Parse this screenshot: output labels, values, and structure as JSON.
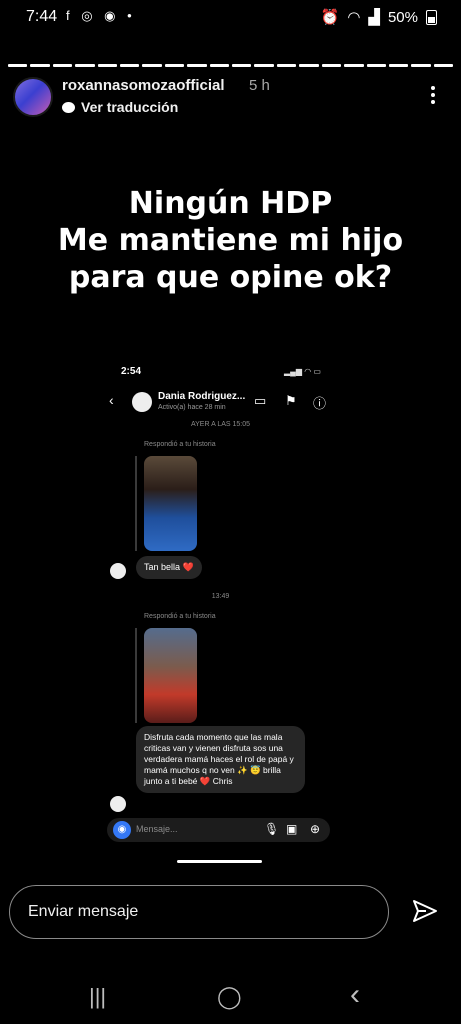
{
  "status_bar": {
    "time": "7:44",
    "app_icons": "f ◎ ◉ •",
    "battery": "50%"
  },
  "story": {
    "username": "roxannasomozaofficial",
    "age": "5 h",
    "translate": "Ver traducción",
    "text_lines": [
      "Ningún HDP",
      "Me mantiene mi hijo",
      "para que opine ok?"
    ]
  },
  "embedded": {
    "time": "2:54",
    "contact_name": "Dania Rodriguez...",
    "contact_status": "Activo(a) hace 28 min",
    "date_divider": "AYER A LAS 15:05",
    "replied_1": "Respondió a tu historia",
    "message_1": "Tan bella ❤️",
    "time_divider": "13:49",
    "replied_2": "Respondió a tu historia",
    "message_2": "Disfruta cada momento que las mala criticas van y vienen disfruta sos una verdadera mamá haces el rol de papá y mamá muchos q no ven ✨ 😇 brilla junto a ti bebé ❤️ Chris",
    "input_placeholder": "Mensaje..."
  },
  "reply": {
    "placeholder": "Enviar mensaje"
  },
  "nav": {
    "recents": "|||",
    "home": "◯",
    "back": "‹"
  },
  "icons": [
    "facebook-icon",
    "instagram-icon",
    "messenger-icon",
    "alarm-icon",
    "wifi-icon",
    "signal-icon",
    "battery-icon",
    "more-options-icon",
    "send-icon"
  ]
}
